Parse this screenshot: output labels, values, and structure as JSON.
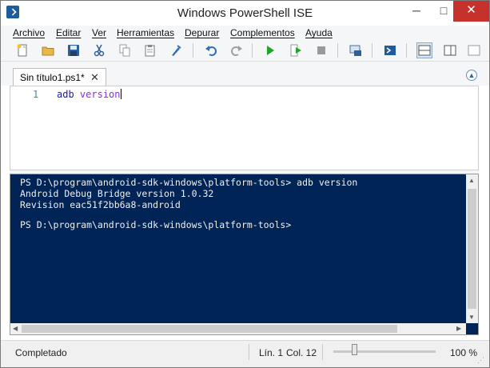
{
  "window": {
    "title": "Windows PowerShell ISE",
    "controls": {
      "minimize": "─",
      "maximize": "□",
      "close": "✕"
    }
  },
  "menu": {
    "items": [
      "Archivo",
      "Editar",
      "Ver",
      "Herramientas",
      "Depurar",
      "Complementos",
      "Ayuda"
    ]
  },
  "toolbar": {
    "buttons": [
      "new-script-icon",
      "open-icon",
      "save-icon",
      "cut-icon",
      "copy-icon",
      "paste-icon",
      "clear-icon",
      "undo-icon",
      "redo-icon",
      "run-icon",
      "run-selection-icon",
      "stop-icon",
      "remote-icon",
      "powershell-icon",
      "layout-top-icon",
      "layout-right-icon"
    ]
  },
  "tabs": [
    {
      "label": "Sin título1.ps1*",
      "close": "✕"
    }
  ],
  "collapse_glyph": "▲",
  "editor": {
    "line_number": "1",
    "command": "adb",
    "argument": "version"
  },
  "console": {
    "lines": [
      "PS D:\\program\\android-sdk-windows\\platform-tools> adb version",
      "Android Debug Bridge version 1.0.32",
      "Revision eac51f2bb6a8-android",
      "",
      "PS D:\\program\\android-sdk-windows\\platform-tools>"
    ],
    "scroll_arrows": {
      "up": "▲",
      "down": "▼",
      "left": "◀",
      "right": "▶"
    }
  },
  "status": {
    "text": "Completado",
    "line": "Lín. 1",
    "column": "Col. 12",
    "zoom": "100 %"
  },
  "colors": {
    "console_background": "#012456",
    "close_button": "#c7312c",
    "run_icon": "#1ea52a"
  }
}
